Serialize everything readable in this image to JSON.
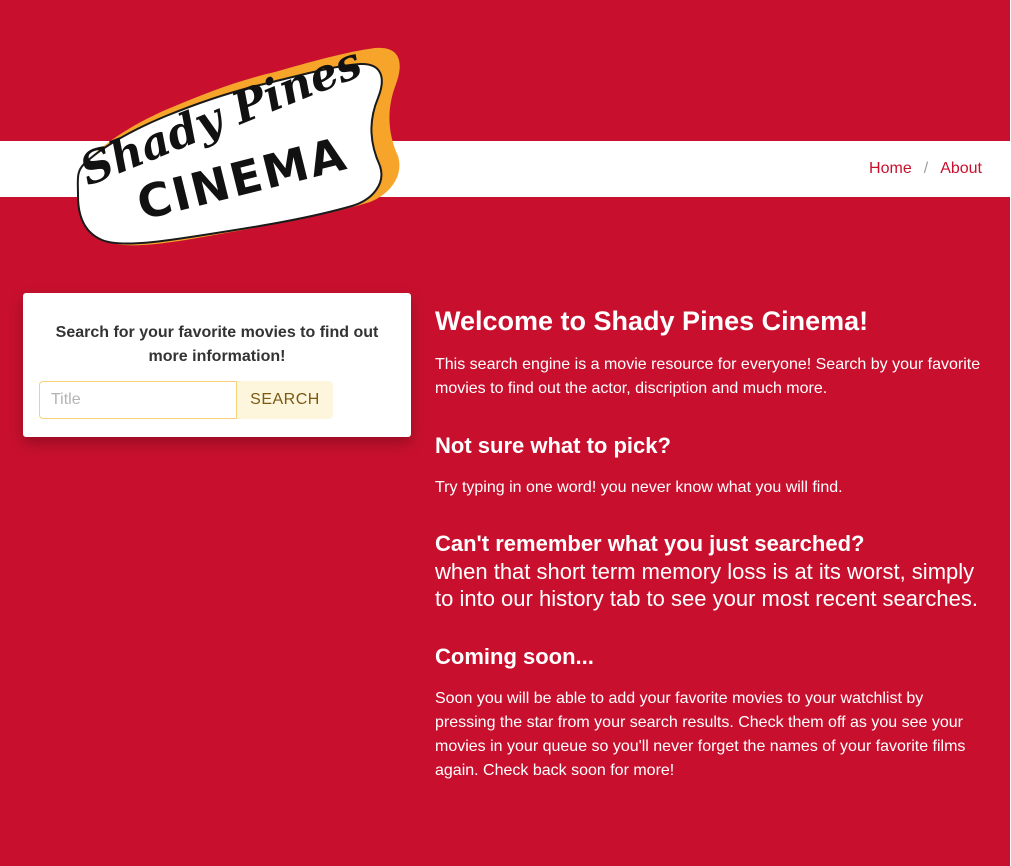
{
  "nav": {
    "home_label": "Home",
    "separator": "/",
    "about_label": "About"
  },
  "logo": {
    "line1": "Shady Pines",
    "line2": "CINEMA"
  },
  "search": {
    "heading": "Search for your favorite movies to find out more information!",
    "placeholder": "Title",
    "value": "",
    "button_label": "SEARCH"
  },
  "main": {
    "title": "Welcome to Shady Pines Cinema!",
    "intro": "This search engine is a movie resource for everyone! Search by your favorite movies to find out the actor, discription and much more.",
    "pick_heading": "Not sure what to pick?",
    "pick_text": "Try typing in one word! you never know what you will find.",
    "remember_heading": "Can't remember what you just searched?",
    "remember_text": "when that short term memory loss is at its worst, simply to into our history tab to see your most recent searches.",
    "coming_heading": "Coming soon...",
    "coming_text": "Soon you will be able to add your favorite movies to your watchlist by pressing the star from your search results. Check them off as you see your movies in your queue so you'll never forget the names of your favorite films again. Check back soon for more!"
  },
  "colors": {
    "brand_red": "#c8102e",
    "logo_orange": "#f7a52a",
    "search_button_bg": "#fdf5dc"
  }
}
